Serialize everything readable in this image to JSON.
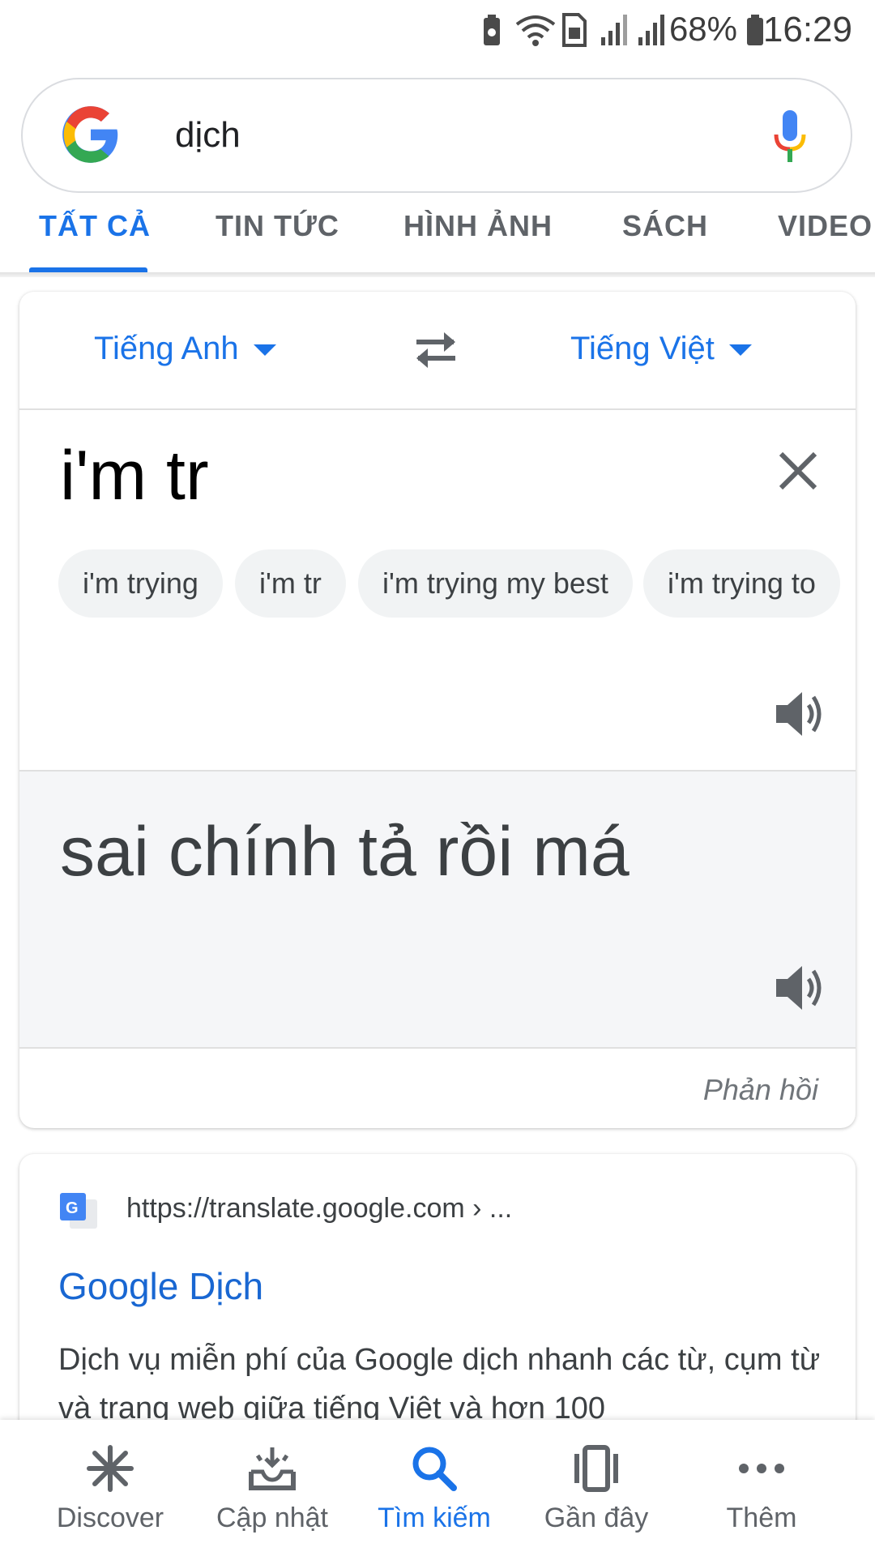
{
  "status_bar": {
    "battery_percent": "68%",
    "time": "16:29"
  },
  "search": {
    "query": "dịch"
  },
  "tabs": [
    {
      "label": "TẤT CẢ",
      "active": true
    },
    {
      "label": "TIN TỨC",
      "active": false
    },
    {
      "label": "HÌNH ẢNH",
      "active": false
    },
    {
      "label": "SÁCH",
      "active": false
    },
    {
      "label": "VIDEO",
      "active": false
    }
  ],
  "translate": {
    "source_lang": "Tiếng Anh",
    "target_lang": "Tiếng Việt",
    "source_text": "i'm tr",
    "suggestions": [
      "i'm trying",
      "i'm tr",
      "i'm trying my best",
      "i'm trying to"
    ],
    "translation": "sai chính tả rồi má",
    "feedback_label": "Phản hồi"
  },
  "result": {
    "url": "https://translate.google.com › ...",
    "title": "Google Dịch",
    "snippet": "Dịch vụ miễn phí của Google dịch nhanh các từ, cụm từ và trang web giữa tiếng Việt và hơn 100"
  },
  "bottom_nav": [
    {
      "label": "Discover",
      "icon": "asterisk-icon",
      "active": false
    },
    {
      "label": "Cập nhật",
      "icon": "updates-tray-icon",
      "active": false
    },
    {
      "label": "Tìm kiếm",
      "icon": "search-icon",
      "active": true
    },
    {
      "label": "Gần đây",
      "icon": "recent-cards-icon",
      "active": false
    },
    {
      "label": "Thêm",
      "icon": "more-dots-icon",
      "active": false
    }
  ],
  "colors": {
    "accent": "#1a73e8",
    "link": "#1967d2"
  }
}
